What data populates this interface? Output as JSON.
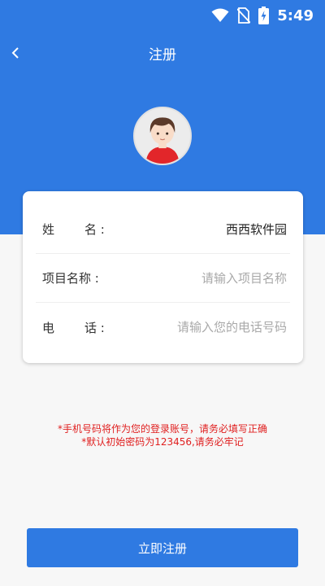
{
  "colors": {
    "primary": "#2f7ae2",
    "notice": "#e02020",
    "background": "#f7f7f7"
  },
  "status_bar": {
    "time": "5:49",
    "icons": [
      "wifi-icon",
      "no-sim-icon",
      "battery-charging-icon"
    ]
  },
  "nav": {
    "title": "注册",
    "back_icon": "chevron-left-icon"
  },
  "avatar": {
    "icon": "user-avatar-icon"
  },
  "form": {
    "name": {
      "label_a": "姓",
      "label_b": "名 :",
      "value": "西西软件园"
    },
    "project": {
      "label": "项目名称 :",
      "placeholder": "请输入项目名称"
    },
    "phone": {
      "label_a": "电",
      "label_b": "话 :",
      "placeholder": "请输入您的电话号码"
    }
  },
  "notice": {
    "line1": "*手机号码将作为您的登录账号，请务必填写正确",
    "line2": "*默认初始密码为123456,请务必牢记"
  },
  "submit": {
    "label": "立即注册"
  }
}
